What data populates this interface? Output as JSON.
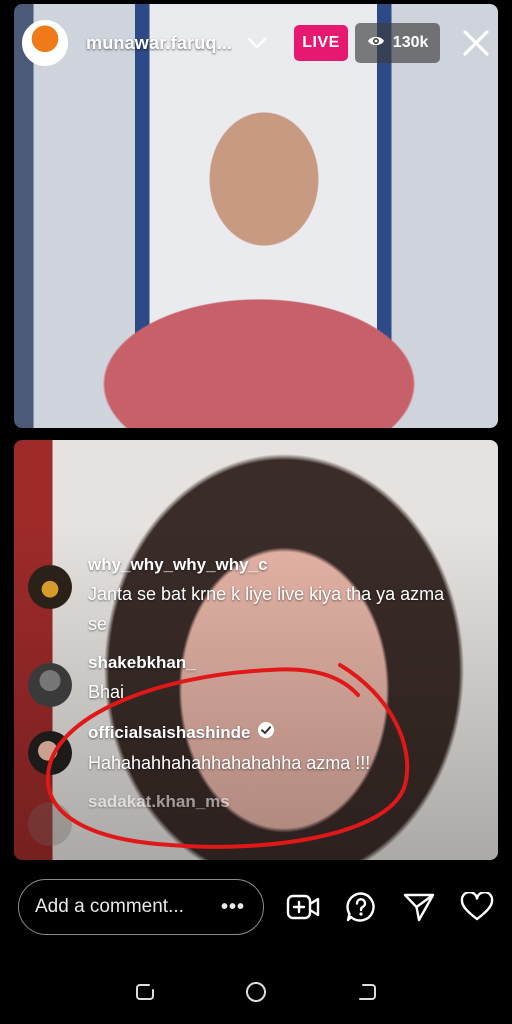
{
  "header": {
    "host_username": "munawar.faruq...",
    "live_label": "LIVE",
    "viewer_count": "130k"
  },
  "comments": [
    {
      "username": "why_why_why_why_c",
      "text": "Janta se bat krne k liye live kiya tha ya azma se",
      "verified": false
    },
    {
      "username": "shakebkhan_",
      "text": "Bhai",
      "verified": false
    },
    {
      "username": "officialsaishashinde",
      "text": "Hahahahhahahhahahahha azma !!!",
      "verified": true
    },
    {
      "username": "sadakat.khan_ms",
      "text": "",
      "verified": false
    }
  ],
  "comment_input": {
    "placeholder": "Add a comment..."
  },
  "icons": {
    "viewers": "eye-icon",
    "close": "close-icon",
    "add_guest": "video-add-icon",
    "question": "question-icon",
    "share": "send-icon",
    "like": "heart-icon"
  },
  "colors": {
    "live_badge": "#e6186f",
    "annotation": "#e01818"
  }
}
